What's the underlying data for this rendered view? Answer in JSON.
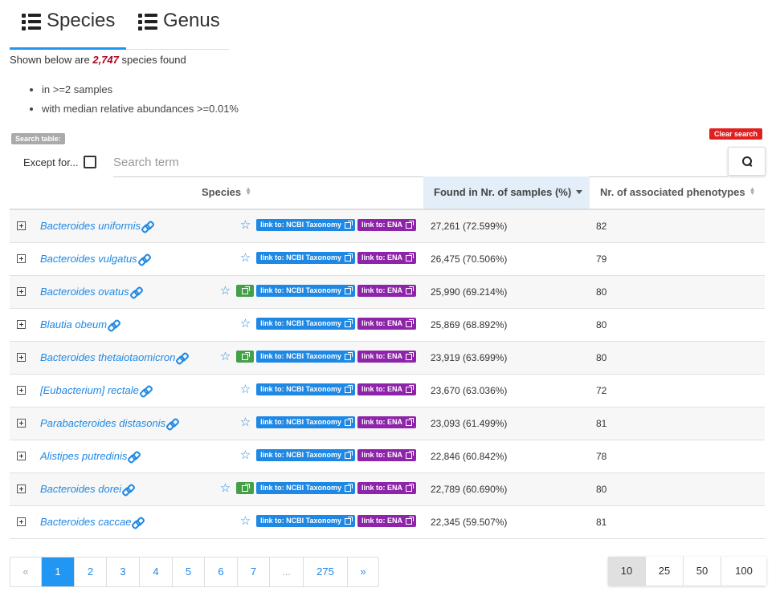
{
  "tabs": [
    {
      "label": "Species",
      "active": true
    },
    {
      "label": "Genus",
      "active": false
    }
  ],
  "summary": {
    "prefix": "Shown below are",
    "count": "2,747",
    "suffix": "species found"
  },
  "criteria": [
    "in >=2 samples",
    "with median relative abundances >=0.01%"
  ],
  "search": {
    "label": "Search table:",
    "clear_label": "Clear search",
    "except_label": "Except for...",
    "placeholder": "Search term"
  },
  "table": {
    "headers": {
      "species": "Species",
      "found": "Found in Nr. of samples (%)",
      "phenotypes": "Nr. of associated phenotypes"
    },
    "badges": {
      "ncbi": "link to: NCBI Taxonomy",
      "ena": "link to: ENA"
    },
    "rows": [
      {
        "species": "Bacteroides uniformis",
        "green": false,
        "found": "27,261 (72.599%)",
        "phenotypes": "82"
      },
      {
        "species": "Bacteroides vulgatus",
        "green": false,
        "found": "26,475 (70.506%)",
        "phenotypes": "79"
      },
      {
        "species": "Bacteroides ovatus",
        "green": true,
        "found": "25,990 (69.214%)",
        "phenotypes": "80"
      },
      {
        "species": "Blautia obeum",
        "green": false,
        "found": "25,869 (68.892%)",
        "phenotypes": "80"
      },
      {
        "species": "Bacteroides thetaiotaomicron",
        "green": true,
        "found": "23,919 (63.699%)",
        "phenotypes": "80"
      },
      {
        "species": "[Eubacterium] rectale",
        "green": false,
        "found": "23,670 (63.036%)",
        "phenotypes": "72"
      },
      {
        "species": "Parabacteroides distasonis",
        "green": false,
        "found": "23,093 (61.499%)",
        "phenotypes": "81"
      },
      {
        "species": "Alistipes putredinis",
        "green": false,
        "found": "22,846 (60.842%)",
        "phenotypes": "78"
      },
      {
        "species": "Bacteroides dorei",
        "green": true,
        "found": "22,789 (60.690%)",
        "phenotypes": "80"
      },
      {
        "species": "Bacteroides caccae",
        "green": false,
        "found": "22,345 (59.507%)",
        "phenotypes": "81"
      }
    ]
  },
  "pagination": {
    "pages": [
      "«",
      "1",
      "2",
      "3",
      "4",
      "5",
      "6",
      "7",
      "...",
      "275",
      "»"
    ],
    "active": "1"
  },
  "page_sizes": {
    "options": [
      "10",
      "25",
      "50",
      "100"
    ],
    "active": "10"
  },
  "colors": {
    "accent": "#2196f3",
    "ncbi_badge": "#1e88e5",
    "ena_badge": "#8e24aa",
    "green_badge": "#43a047",
    "clear_search": "#e02020",
    "count": "#b00020"
  }
}
